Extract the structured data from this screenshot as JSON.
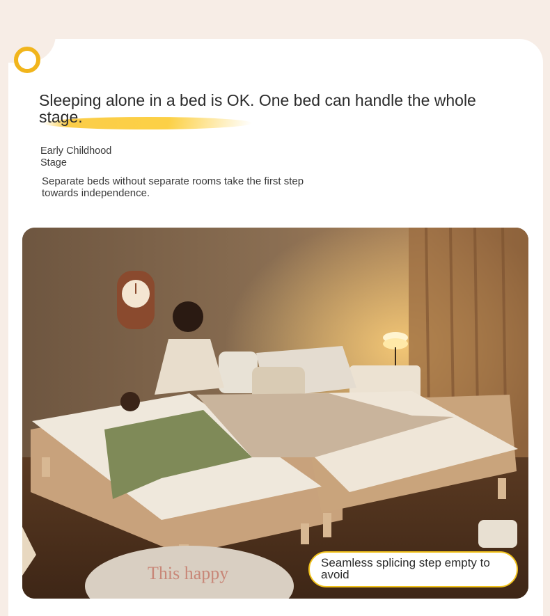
{
  "section": {
    "title": "Sleeping alone in a bed is OK. One bed can handle the whole stage.",
    "stage_label": "Early Childhood Stage",
    "description": "Separate beds without separate rooms take the first step towards independence."
  },
  "photo": {
    "caption": "Seamless splicing step empty to avoid",
    "rug_text": "This happy"
  },
  "colors": {
    "accent": "#f1b51c",
    "page_background": "#f7ede6",
    "card_background": "#ffffff"
  },
  "icons": {
    "decoration": "ring-bullet-icon"
  }
}
